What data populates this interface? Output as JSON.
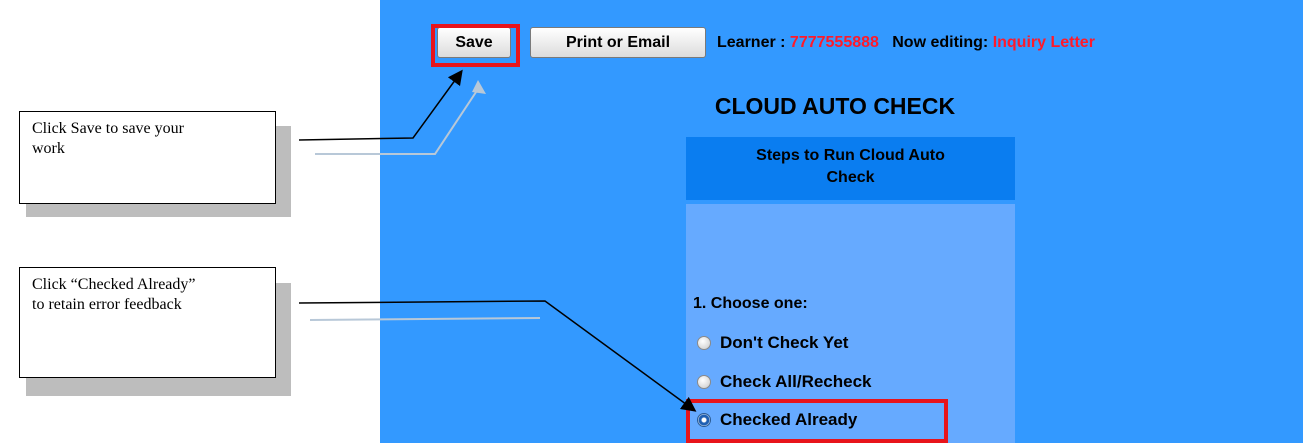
{
  "toolbar": {
    "save_label": "Save",
    "print_label": "Print or Email",
    "learner_label": "Learner :",
    "learner_id": "7777555888",
    "editing_label": "Now editing:",
    "editing_doc": "Inquiry Letter"
  },
  "main": {
    "title": "CLOUD AUTO CHECK",
    "steps_header": "Steps to Run Cloud Auto Check",
    "step1_label": "1. Choose one:",
    "options": [
      {
        "label": "Don't Check Yet",
        "selected": false
      },
      {
        "label": "Check All/Recheck",
        "selected": false
      },
      {
        "label": "Checked Already",
        "selected": true
      }
    ]
  },
  "callouts": {
    "save_note": "Click Save to save your work",
    "checked_note": "Click “Checked Already” to retain error feedback"
  },
  "colors": {
    "panel": "#3399ff",
    "header": "#0a7df0",
    "body": "#66aaff",
    "highlight": "#e8141b",
    "accent_text": "#ff1a2a"
  }
}
